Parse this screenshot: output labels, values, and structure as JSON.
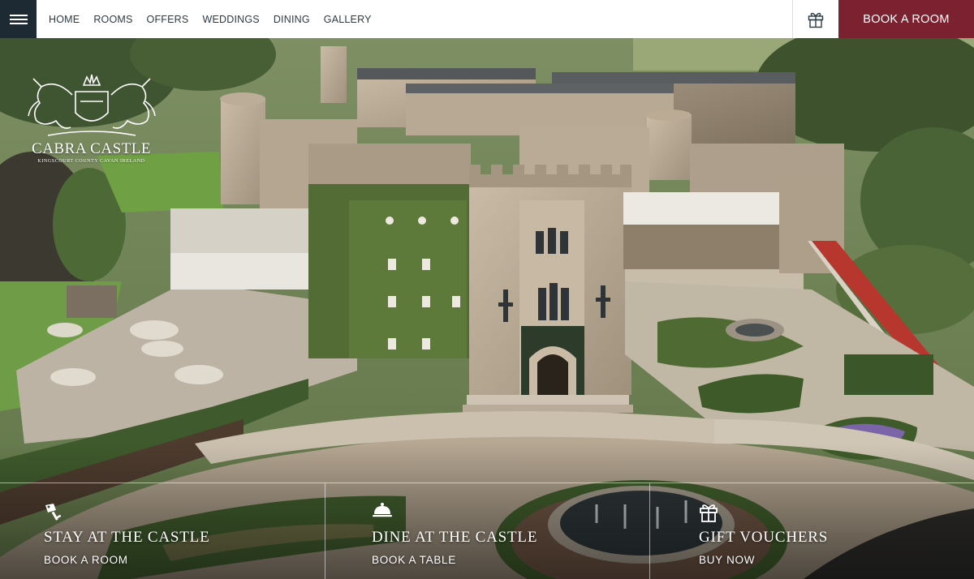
{
  "nav": {
    "menu_icon": "hamburger-menu-icon",
    "items": [
      {
        "label": "HOME"
      },
      {
        "label": "ROOMS"
      },
      {
        "label": "OFFERS"
      },
      {
        "label": "WEDDINGS"
      },
      {
        "label": "DINING"
      },
      {
        "label": "GALLERY"
      }
    ],
    "gift_icon": "gift-icon",
    "book_label": "BOOK A ROOM"
  },
  "logo": {
    "name": "CABRA CASTLE",
    "subtitle": "KINGSCOURT COUNTY CAVAN IRELAND"
  },
  "ctas": [
    {
      "icon": "key-tag-icon",
      "title": "STAY AT THE CASTLE",
      "action": "BOOK A ROOM"
    },
    {
      "icon": "cloche-icon",
      "title": "DINE AT THE CASTLE",
      "action": "BOOK A TABLE"
    },
    {
      "icon": "gift-icon",
      "title": "GIFT VOUCHERS",
      "action": "BUY NOW"
    }
  ],
  "colors": {
    "header_bg": "#ffffff",
    "menu_bg": "#1e2a33",
    "book_bg": "#7c2130",
    "nav_text": "#2c3a44"
  }
}
